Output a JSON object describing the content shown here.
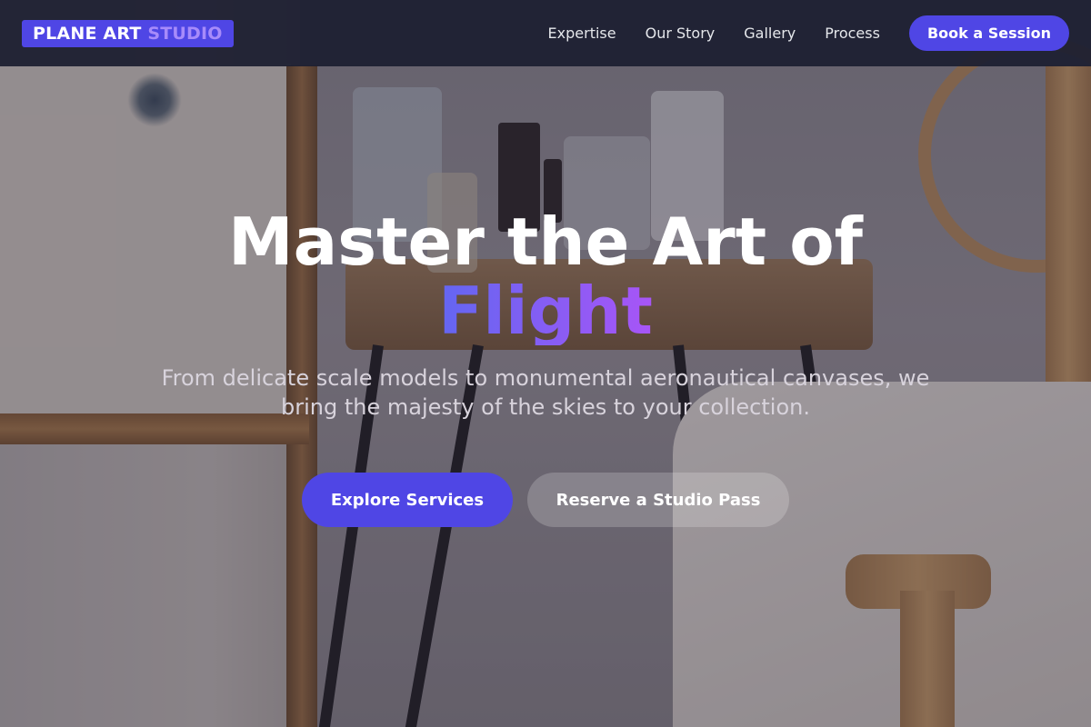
{
  "brand": {
    "name_main": "PLANE ART",
    "name_accent": "STUDIO"
  },
  "nav": {
    "links": [
      "Expertise",
      "Our Story",
      "Gallery",
      "Process"
    ],
    "cta": "Book a Session"
  },
  "hero": {
    "headline_line1": "Master the Art of",
    "headline_highlight": "Flight",
    "subtitle": "From delicate scale models to monumental aeronautical canvases, we bring the majesty of the skies to your collection.",
    "primary_button": "Explore Services",
    "secondary_button": "Reserve a Studio Pass"
  },
  "colors": {
    "accent": "#4f46e5",
    "accent_light": "#a78bfa",
    "nav_background": "#1c1e30",
    "text_light": "#ffffff"
  }
}
